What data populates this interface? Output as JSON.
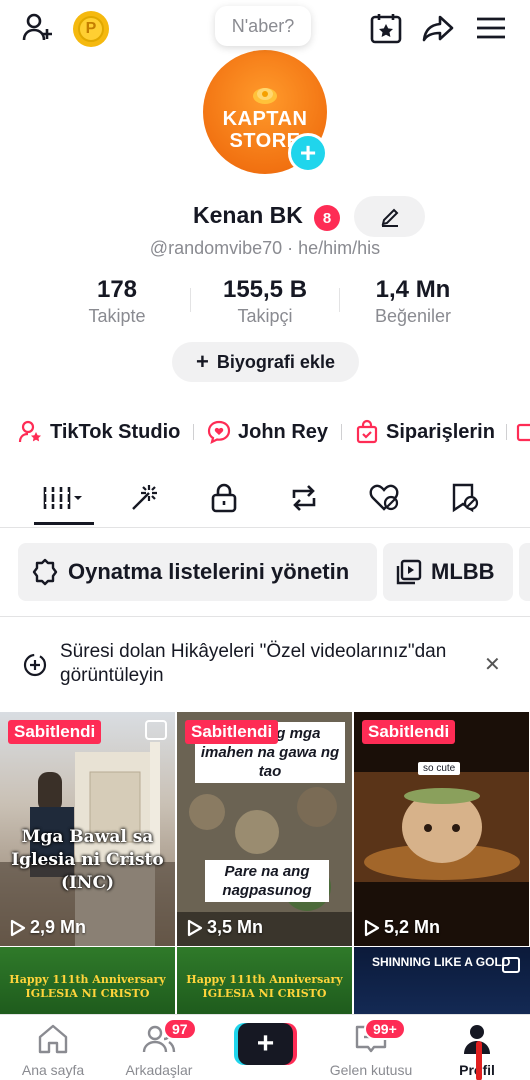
{
  "topbar": {
    "status_bubble": "N'aber?",
    "icons": [
      "add-friend-icon",
      "coin-icon",
      "calendar-star-icon",
      "share-icon",
      "menu-icon"
    ],
    "coin_letter": "P"
  },
  "profile": {
    "avatar_text_line1": "KAPTAN",
    "avatar_text_line2": "STORE",
    "name": "Kenan BK",
    "name_badge": "8",
    "handle": "@randomvibe70 · he/him/his",
    "stats": [
      {
        "value": "178",
        "label": "Takipte"
      },
      {
        "value": "155,5 B",
        "label": "Takipçi"
      },
      {
        "value": "1,4 Mn",
        "label": "Beğeniler"
      }
    ],
    "bio_button": "Biyografi ekle"
  },
  "links": [
    {
      "label": "TikTok Studio",
      "icon": "person-star-icon"
    },
    {
      "label": "John Rey",
      "icon": "chat-heart-icon"
    },
    {
      "label": "Siparişlerin",
      "icon": "bag-icon"
    }
  ],
  "tabs": [
    "grid-icon",
    "sparkle-icon",
    "lock-icon",
    "repost-icon",
    "liked-hidden-icon",
    "bookmark-hidden-icon"
  ],
  "chips": [
    {
      "label": "Oynatma listelerini yönetin",
      "icon": "gear-icon"
    },
    {
      "label": "MLBB",
      "icon": "playlist-icon"
    }
  ],
  "notice": {
    "text": "Süresi dolan Hikâyeleri \"Özel videolarınız\"dan görüntüleyin"
  },
  "videos": [
    {
      "pinned": "Sabitlendi",
      "views": "2,9 Mn",
      "overlay": "Mga Bawal sa Iglesia ni Cristo (INC)"
    },
    {
      "pinned": "Sabitlendi",
      "views": "3,5 Mn",
      "overlay_top": "ahen ang mga imahen na gawa ng tao",
      "overlay_bottom": "Pare na ang nagpasunog"
    },
    {
      "pinned": "Sabitlendi",
      "views": "5,2 Mn",
      "overlay": "so cute"
    }
  ],
  "videos_row2": [
    {
      "line1": "Happy 111th Anniversary",
      "line2": "IGLESIA NI CRISTO"
    },
    {
      "line1": "Happy 111th Anniversary",
      "line2": "IGLESIA NI CRISTO"
    },
    {
      "line1": "SHINNING LIKE A GOLD"
    }
  ],
  "bottom_nav": {
    "items": [
      {
        "label": "Ana sayfa"
      },
      {
        "label": "Arkadaşlar",
        "badge": "97"
      },
      {
        "label": ""
      },
      {
        "label": "Gelen kutusu",
        "badge": "99+"
      },
      {
        "label": "Profil"
      }
    ]
  },
  "colors": {
    "accent": "#fe2c55",
    "cyan": "#20d5ec",
    "text": "#161823",
    "muted": "#8a8b91"
  }
}
